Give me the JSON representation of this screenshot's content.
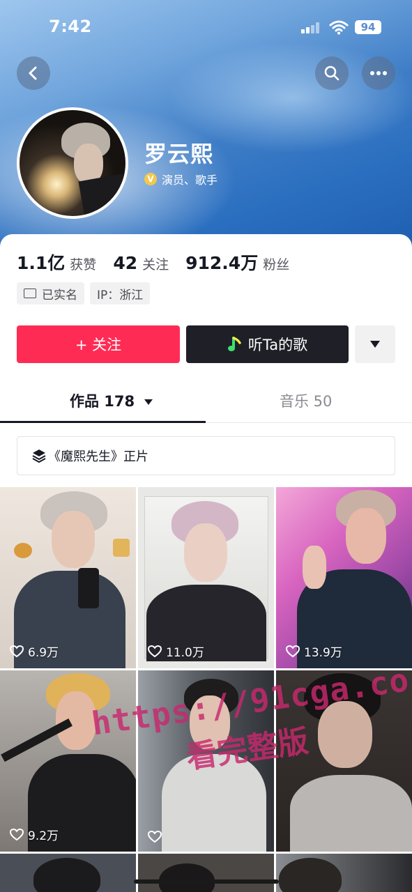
{
  "status_bar": {
    "time": "7:42",
    "battery": "94"
  },
  "header": {
    "back_icon": "chevron-left-icon",
    "search_icon": "search-icon",
    "more_icon": "ellipsis-icon"
  },
  "profile": {
    "name": "罗云熙",
    "verification": "演员、歌手",
    "badge_icon": "v-badge-icon"
  },
  "stats": {
    "likes_value": "1.1亿",
    "likes_label": "获赞",
    "following_value": "42",
    "following_label": "关注",
    "followers_value": "912.4万",
    "followers_label": "粉丝"
  },
  "tags": {
    "real_name": "已实名",
    "ip": "IP：浙江"
  },
  "actions": {
    "follow": "+ 关注",
    "listen": "听Ta的歌"
  },
  "tabs": {
    "works_label": "作品 178",
    "music_label": "音乐 50"
  },
  "playlist": {
    "label": "《魔熙先生》正片"
  },
  "videos": [
    {
      "likes": "6.9万"
    },
    {
      "likes": "11.0万"
    },
    {
      "likes": "13.9万"
    },
    {
      "likes": "9.2万"
    },
    {
      "likes": ""
    },
    {
      "likes": ""
    }
  ],
  "watermark": {
    "line1": "https://91cga.co",
    "line2": "看完整版"
  },
  "colors": {
    "follow": "#fe2c55",
    "dark_button": "#1f1f27",
    "accent_blue": "#2b6fc0"
  }
}
